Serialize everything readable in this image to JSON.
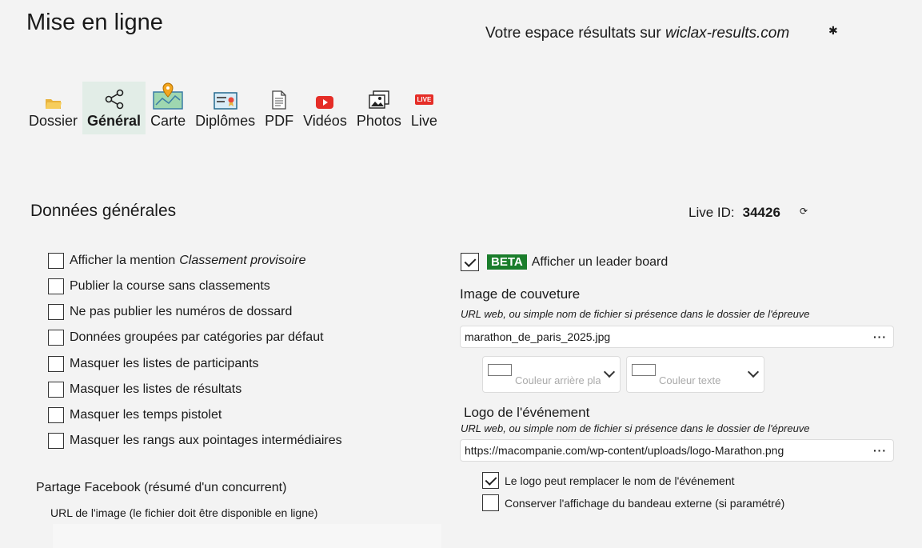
{
  "header": {
    "title": "Mise en ligne",
    "space_text": "Votre espace résultats sur",
    "space_brand": "wiclax-results.com"
  },
  "toolbar": [
    {
      "label": "Dossier",
      "icon": "folder-icon"
    },
    {
      "label": "Général",
      "icon": "share-icon",
      "active": true
    },
    {
      "label": "Carte",
      "icon": "map-icon"
    },
    {
      "label": "Diplômes",
      "icon": "diploma-icon"
    },
    {
      "label": "PDF",
      "icon": "pdf-icon"
    },
    {
      "label": "Vidéos",
      "icon": "youtube-icon"
    },
    {
      "label": "Photos",
      "icon": "photos-icon"
    },
    {
      "label": "Live",
      "icon": "live-icon",
      "icon_text": "LIVE"
    }
  ],
  "general": {
    "section_title": "Données générales",
    "live_id_label": "Live ID:",
    "live_id_value": "34426",
    "options": [
      {
        "label": "Afficher la mention",
        "italic": "Classement provisoire",
        "checked": false
      },
      {
        "label": "Publier la course sans classements",
        "checked": false
      },
      {
        "label": "Ne pas publier les numéros de dossard",
        "checked": false
      },
      {
        "label": "Données groupées par catégories par défaut",
        "checked": false
      },
      {
        "label": "Masquer les listes de participants",
        "checked": false
      },
      {
        "label": "Masquer les listes de résultats",
        "checked": false
      },
      {
        "label": "Masquer les temps pistolet",
        "checked": false
      },
      {
        "label": "Masquer les rangs aux pointages intermédiaires",
        "checked": false
      }
    ],
    "leaderboard": {
      "badge": "BETA",
      "label": "Afficher un leader board",
      "checked": true
    }
  },
  "cover": {
    "title": "Image de couveture",
    "hint": "URL web, ou simple nom de fichier si présence dans le dossier de l'épreuve",
    "value": "marathon_de_paris_2025.jpg",
    "bg_color_placeholder": "Couleur arrière pla",
    "text_color_placeholder": "Couleur texte"
  },
  "logo": {
    "title": "Logo de l'événement",
    "hint": "URL web, ou simple nom de fichier si présence dans le dossier de l'épreuve",
    "value": "https://macompanie.com/wp-content/uploads/logo-Marathon.png",
    "replace_name": {
      "label": "Le logo peut remplacer le nom de l'événement",
      "checked": true
    },
    "keep_banner": {
      "label": "Conserver l'affichage du bandeau externe (si paramétré)",
      "checked": false
    }
  },
  "facebook": {
    "title": "Partage Facebook (résumé d'un concurrent)",
    "url_label": "URL de l'image (le fichier doit être disponible en ligne)"
  },
  "ellipsis": "···"
}
